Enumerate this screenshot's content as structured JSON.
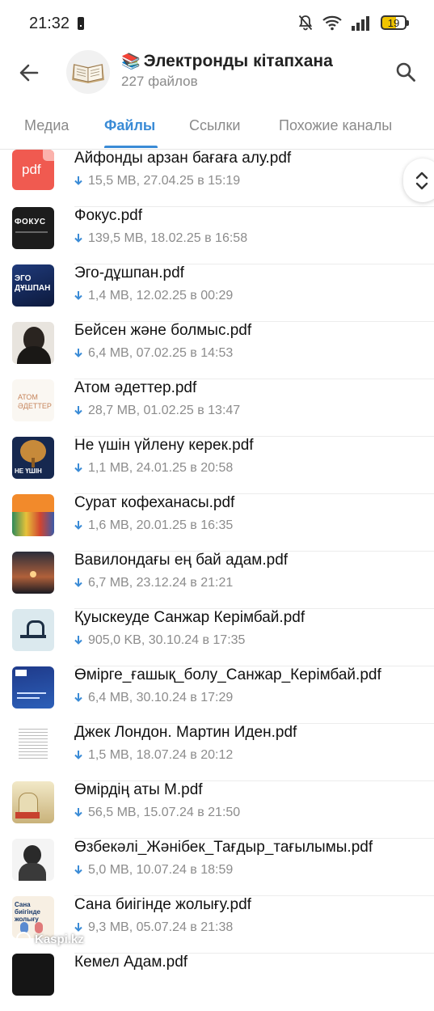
{
  "status_bar": {
    "time": "21:32",
    "battery": "19"
  },
  "header": {
    "title": "Электронды кітапхана",
    "title_emoji": "📚",
    "subtitle": "227 файлов",
    "back_icon": "arrow-left-icon",
    "search_icon": "search-icon"
  },
  "tabs": [
    {
      "label": "Медиа",
      "active": false
    },
    {
      "label": "Файлы",
      "active": true
    },
    {
      "label": "Ссылки",
      "active": false
    },
    {
      "label": "Похожие каналы",
      "active": false
    }
  ],
  "colors": {
    "accent": "#3a8bd6",
    "pdf_red": "#f05a50",
    "download_arrow": "#3a8bd6"
  },
  "files": [
    {
      "name": "Айфонды арзан бағаға алу.pdf",
      "meta": "15,5 MB, 27.04.25 в 15:19",
      "thumb": "pdf"
    },
    {
      "name": "Фокус.pdf",
      "meta": "139,5 MB, 18.02.25 в 16:58",
      "thumb": "ФОКУС"
    },
    {
      "name": "Эго-дұшпан.pdf",
      "meta": "1,4 MB, 12.02.25 в 00:29",
      "thumb": "ЭГО ДҰШПАН"
    },
    {
      "name": "Бейсен және болмыс.pdf",
      "meta": "6,4 MB, 07.02.25 в 14:53",
      "thumb": ""
    },
    {
      "name": "Атом әдеттер.pdf",
      "meta": "28,7 MB, 01.02.25 в 13:47",
      "thumb": "АТОМ ӘДЕТТЕР"
    },
    {
      "name": "Не үшін үйлену керек.pdf",
      "meta": "1,1 MB, 24.01.25 в 20:58",
      "thumb": "НЕ ҮШІН"
    },
    {
      "name": "Сурат кофеханасы.pdf",
      "meta": "1,6 MB, 20.01.25 в 16:35",
      "thumb": ""
    },
    {
      "name": "Вавилондағы ең бай адам.pdf",
      "meta": "6,7 MB, 23.12.24 в 21:21",
      "thumb": ""
    },
    {
      "name": "Қуыскеуде Санжар Керімбай.pdf",
      "meta": "905,0 KB, 30.10.24 в 17:35",
      "thumb": ""
    },
    {
      "name": "Өмірге_ғашық_болу_Санжар_Керімбай.pdf",
      "meta": "6,4 MB, 30.10.24 в 17:29",
      "thumb": ""
    },
    {
      "name": "Джек Лондон. Мартин Иден.pdf",
      "meta": "1,5 MB, 18.07.24 в 20:12",
      "thumb": ""
    },
    {
      "name": "Өмірдің аты М.pdf",
      "meta": "56,5 MB, 15.07.24 в 21:50",
      "thumb": ""
    },
    {
      "name": "Өзбекәлі_Жәнібек_Тағдыр_тағылымы.pdf",
      "meta": "5,0 MB, 10.07.24 в 18:59",
      "thumb": ""
    },
    {
      "name": "Сана биігінде жолығу.pdf",
      "meta": "9,3 MB, 05.07.24 в 21:38",
      "thumb": "Сана биігінде жолығу"
    },
    {
      "name": "Кемел Адам.pdf",
      "meta": "",
      "thumb": ""
    }
  ],
  "watermark": "Kaspi.kz"
}
